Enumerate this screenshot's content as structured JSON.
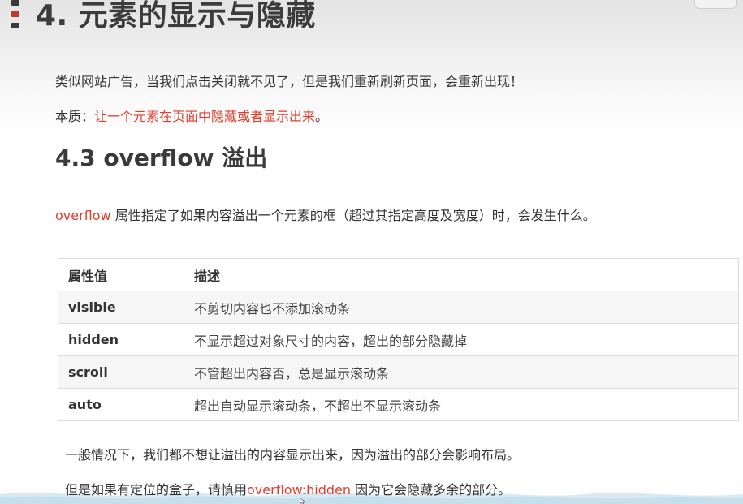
{
  "title": "4. 元素的显示与隐藏",
  "intro": {
    "line1": "类似网站广告，当我们点击关闭就不见了，但是我们重新刷新页面，会重新出现！",
    "essence_prefix": "本质：",
    "essence_highlight": "让一个元素在页面中隐藏或者显示出来",
    "essence_suffix": "。"
  },
  "section": {
    "heading": "4.3 overflow 溢出",
    "desc_keyword": "overflow",
    "desc_rest": " 属性指定了如果内容溢出一个元素的框（超过其指定高度及宽度）时，会发生什么。"
  },
  "table": {
    "headers": [
      "属性值",
      "描述"
    ],
    "rows": [
      {
        "value": "visible",
        "desc": "不剪切内容也不添加滚动条"
      },
      {
        "value": "hidden",
        "desc": "不显示超过对象尺寸的内容，超出的部分隐藏掉"
      },
      {
        "value": "scroll",
        "desc": "不管超出内容否，总是显示滚动条"
      },
      {
        "value": "auto",
        "desc": "超出自动显示滚动条，不超出不显示滚动条"
      }
    ]
  },
  "notes": {
    "line1": "一般情况下，我们都不想让溢出的内容显示出来，因为溢出的部分会影响布局。",
    "line2_prefix": "但是如果有定位的盒子，请慎用",
    "line2_keyword": "overflow:hidden",
    "line2_suffix": " 因为它会隐藏多余的部分。"
  },
  "colors": {
    "highlight": "#e23c2b",
    "title": "#3c3c3c",
    "marker_accent": "#c0392b",
    "wave": "#cfe3ee"
  }
}
